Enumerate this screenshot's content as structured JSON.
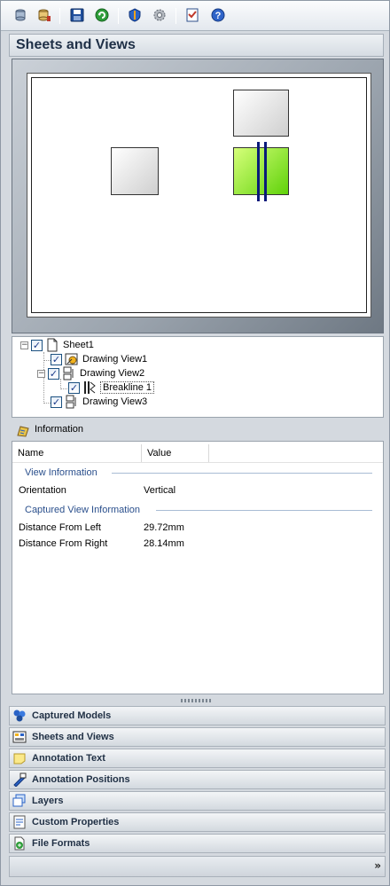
{
  "toolbar": {
    "buttons": [
      "database-icon",
      "database-add-icon",
      "save-icon",
      "refresh-icon",
      "shield-icon",
      "gear-icon",
      "checklist-icon",
      "help-icon"
    ]
  },
  "section": {
    "title": "Sheets and Views"
  },
  "tree": {
    "items": [
      {
        "label": "Sheet1",
        "checked": true,
        "expanded": true
      },
      {
        "label": "Drawing View1",
        "checked": true
      },
      {
        "label": "Drawing View2",
        "checked": true,
        "expanded": true
      },
      {
        "label": "Breakline 1",
        "checked": true,
        "selected": true
      },
      {
        "label": "Drawing View3",
        "checked": true
      }
    ],
    "expand_glyph": "−",
    "check_glyph": "✓"
  },
  "information": {
    "title": "Information",
    "columns": [
      "Name",
      "Value"
    ],
    "groups": [
      {
        "name": "View Information",
        "rows": [
          {
            "name": "Orientation",
            "value": "Vertical"
          }
        ]
      },
      {
        "name": "Captured View Information",
        "rows": [
          {
            "name": "Distance From Left",
            "value": "29.72mm"
          },
          {
            "name": "Distance From Right",
            "value": "28.14mm"
          }
        ]
      }
    ]
  },
  "accordion": {
    "items": [
      "Captured Models",
      "Sheets and Views",
      "Annotation Text",
      "Annotation Positions",
      "Layers",
      "Custom Properties",
      "File Formats"
    ],
    "chevron": "»"
  },
  "colors": {
    "accent": "#1e2f46",
    "selected_view": "#60d20a",
    "breakline": "#0a1a7a"
  }
}
